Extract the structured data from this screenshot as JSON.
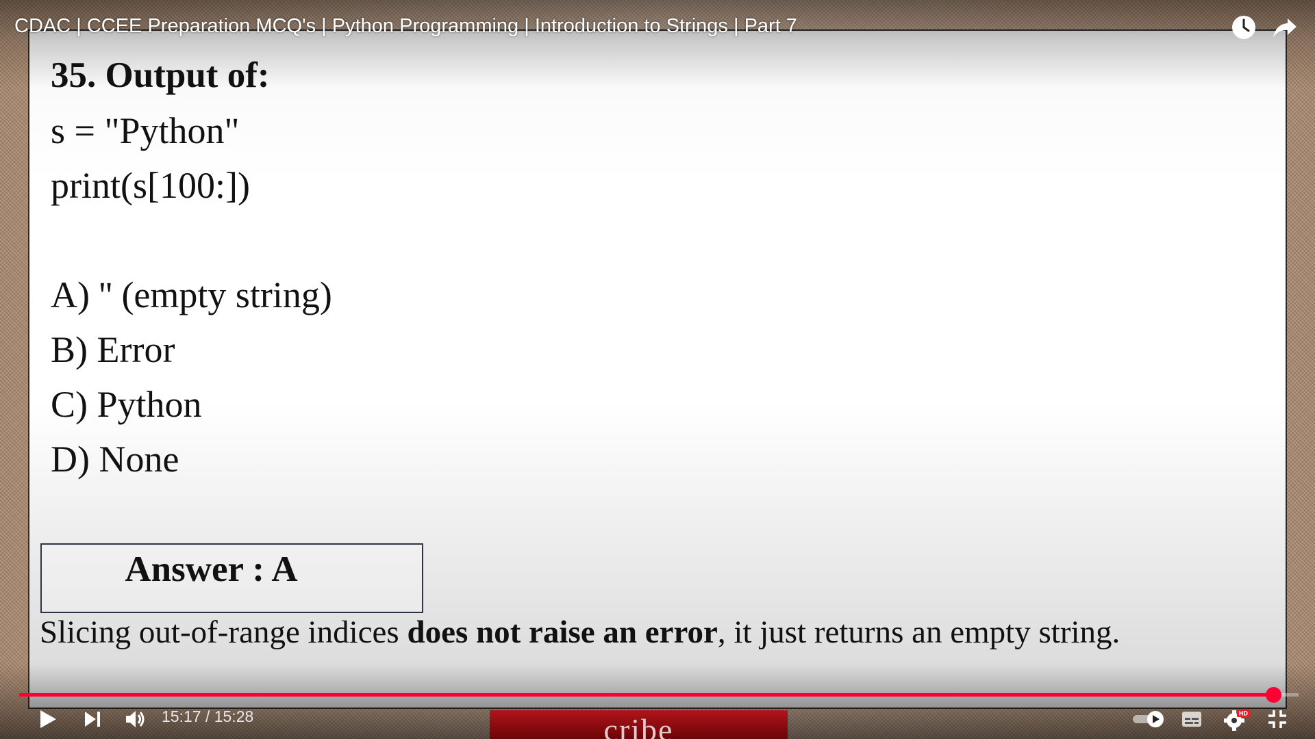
{
  "player": {
    "title": "CDAC | CCEE Preparation MCQ's | Python Programming | Introduction to Strings | Part 7",
    "time_display": "15:17 / 15:28",
    "progress_fraction": 0.98,
    "overlay_text": "cribe",
    "accent_color": "#ff0033",
    "icons": {
      "watch_later": "clock-icon",
      "share": "share-icon",
      "play": "play-icon",
      "next": "next-icon",
      "volume": "volume-icon",
      "autoplay": "autoplay-toggle-icon",
      "subtitles": "subtitles-icon",
      "settings": "settings-gear-icon",
      "settings_badge": "HD",
      "exit_fullscreen": "exit-fullscreen-icon"
    }
  },
  "slide": {
    "heading": "35. Output of:",
    "code": [
      "s = \"Python\"",
      "print(s[100:])"
    ],
    "options": [
      "A) '' (empty string)",
      "B) Error",
      "C) Python",
      "D) None"
    ],
    "answer": "Answer : A",
    "explanation": {
      "before": "Slicing out-of-range indices ",
      "bold": "does not raise an error",
      "after": ", it just returns an empty string."
    }
  }
}
